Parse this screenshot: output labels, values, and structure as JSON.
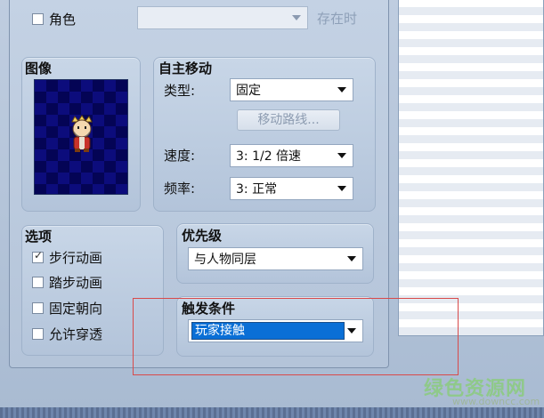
{
  "top": {
    "role_checkbox_label": "角色",
    "role_checked": false,
    "save_label": "存在时"
  },
  "image_panel": {
    "title": "图像"
  },
  "movement": {
    "title": "自主移动",
    "type_label": "类型:",
    "type_value": "固定",
    "route_button": "移动路线...",
    "speed_label": "速度:",
    "speed_value": "3: 1/2 倍速",
    "freq_label": "频率:",
    "freq_value": "3: 正常"
  },
  "options": {
    "title": "选项",
    "items": [
      {
        "label": "步行动画",
        "checked": true
      },
      {
        "label": "踏步动画",
        "checked": false
      },
      {
        "label": "固定朝向",
        "checked": false
      },
      {
        "label": "允许穿透",
        "checked": false
      }
    ]
  },
  "priority": {
    "title": "优先级",
    "value": "与人物同层"
  },
  "trigger": {
    "title": "触发条件",
    "value": "玩家接触"
  },
  "watermark": {
    "name": "绿色资源网",
    "url": "www.downcc.com"
  },
  "colors": {
    "selected_bg": "#0a6fd6",
    "highlight": "#d84a4a",
    "sprite_bg": "#0c0c7c"
  }
}
